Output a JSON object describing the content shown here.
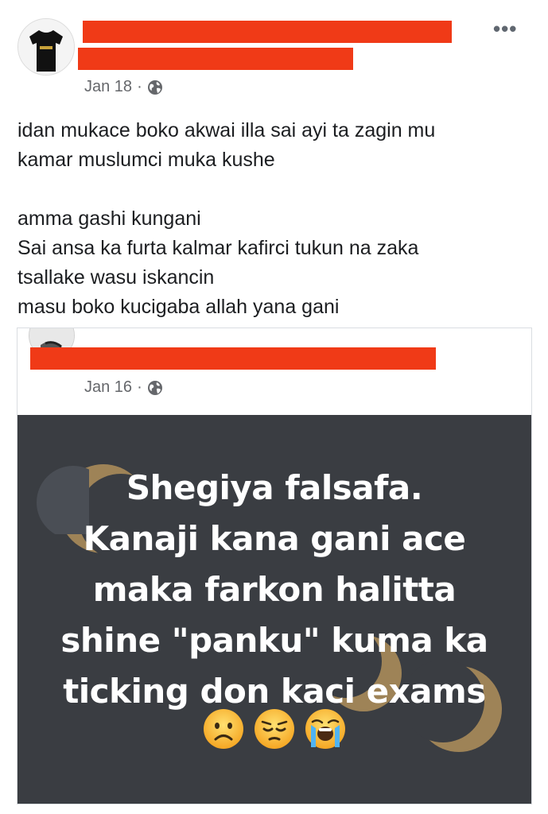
{
  "post": {
    "author_redacted": true,
    "date": "Jan 18",
    "separator": "·",
    "privacy_icon": "globe-icon",
    "more_icon": "more-options-icon",
    "caption": [
      "idan mukace boko akwai illa sai ayi ta zagin mu\nkamar muslumci muka kushe",
      "amma gashi kungani\nSai ansa ka furta kalmar kafirci tukun na zaka\ntsallake wasu iskancin\nmasu boko kucigaba allah yana gani"
    ]
  },
  "shared_post": {
    "author_redacted": true,
    "date": "Jan 16",
    "separator": "·",
    "privacy_icon": "globe-icon",
    "image": {
      "background_color": "#3a3d42",
      "text_color": "#ffffff",
      "lines": [
        "Shegiya falsafa.",
        "Kanaji kana gani ace",
        "maka farkon halitta",
        "shine \"panku\" kuma ka",
        "ticking don kaci exams"
      ],
      "emojis": [
        "frowning-face-emoji",
        "pensive-face-emoji",
        "loudly-crying-face-emoji"
      ]
    }
  },
  "colors": {
    "redaction": "#f03a17",
    "meta_text": "#65676b",
    "moon_gold": "#b08f5b"
  }
}
